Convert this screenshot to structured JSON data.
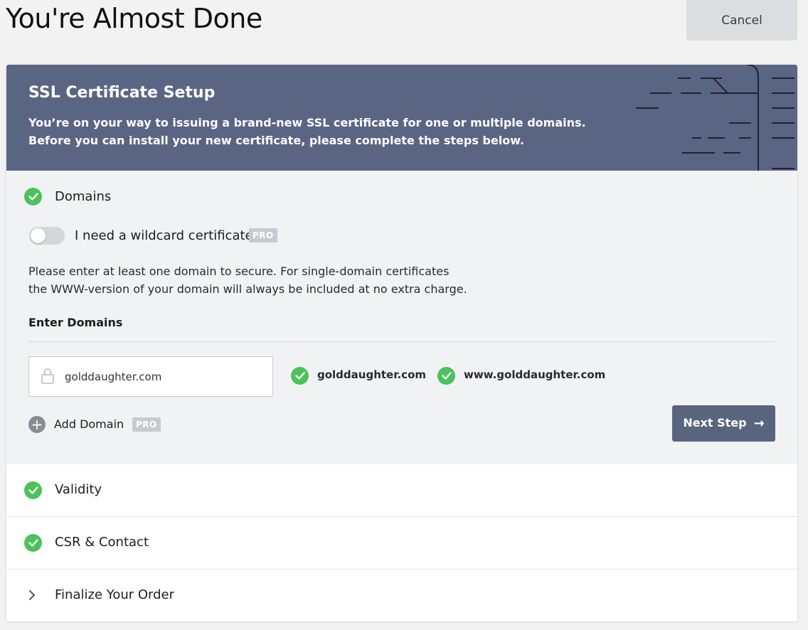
{
  "header": {
    "title": "You're Almost Done",
    "cancel_label": "Cancel"
  },
  "banner": {
    "title": "SSL Certificate Setup",
    "line1": "You’re on your way to issuing a brand-new SSL certificate for one or multiple domains.",
    "line2": "Before you can install your new certificate, please complete the steps below."
  },
  "domains_section": {
    "label": "Domains",
    "wildcard_label": "I need a wildcard certificate",
    "wildcard_enabled": false,
    "pro_badge": "PRO",
    "helper_line1": "Please enter at least one domain to secure. For single-domain certificates",
    "helper_line2": "the WWW-version of your domain will always be included at no extra charge.",
    "enter_label": "Enter Domains",
    "input_value": "golddaughter.com",
    "validated_domains": [
      "golddaughter.com",
      "www.golddaughter.com"
    ],
    "add_domain_label": "Add Domain",
    "next_label": "Next Step"
  },
  "steps": [
    {
      "label": "Validity",
      "status": "complete"
    },
    {
      "label": "CSR & Contact",
      "status": "complete"
    },
    {
      "label": "Finalize Your Order",
      "status": "collapsed"
    }
  ],
  "colors": {
    "banner": "#5a6583",
    "check": "#4cc25a",
    "button": "#59647f"
  }
}
